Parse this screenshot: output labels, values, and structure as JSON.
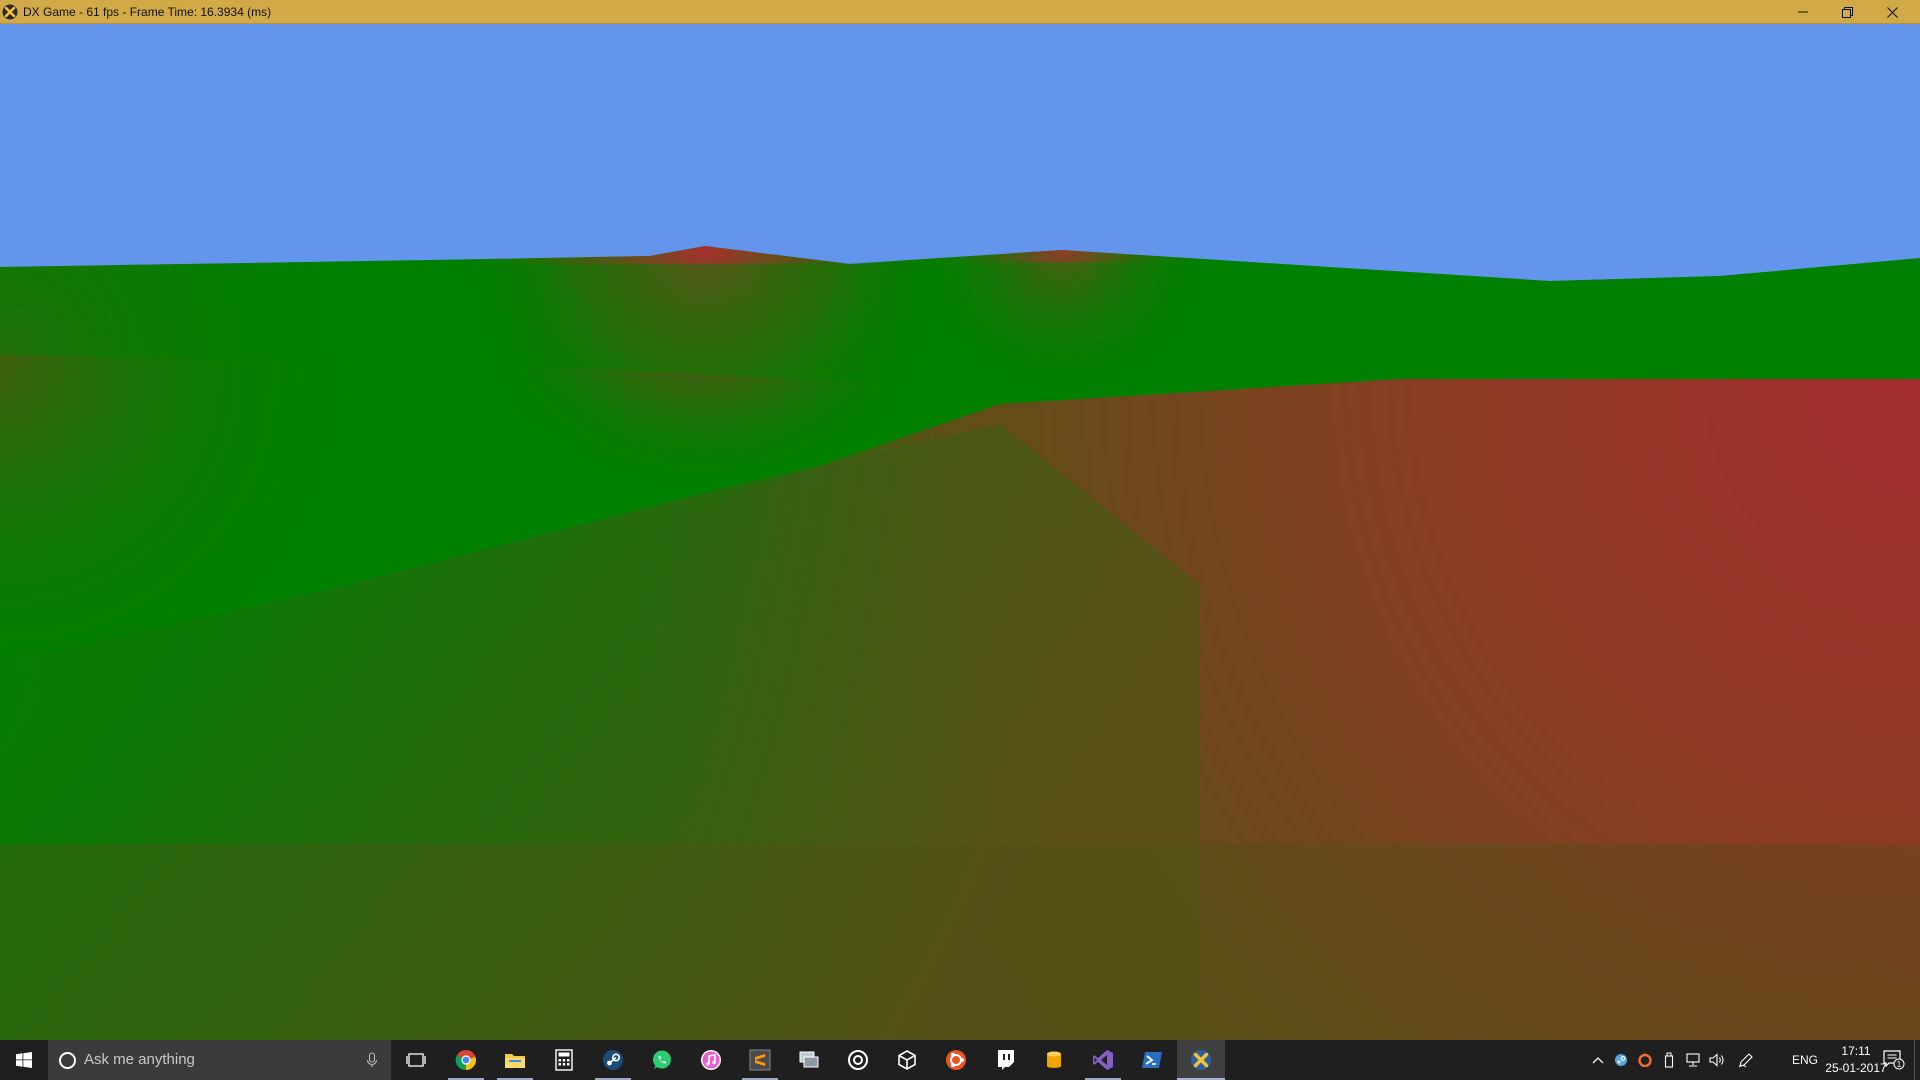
{
  "window": {
    "title": "DX Game - 61 fps - Frame Time: 16.3934 (ms)",
    "icon": "dx-x-icon",
    "controls": [
      "minimize-icon",
      "maximize-icon",
      "close-icon"
    ],
    "titlebar_color": "#d1aa47"
  },
  "scene": {
    "sky_color": "#6495ED",
    "grass_color": "#008000",
    "dirt_color": "#9c2d2d"
  },
  "taskbar": {
    "search_placeholder": "Ask me anything",
    "apps": [
      {
        "name": "task-view-icon",
        "running": false
      },
      {
        "name": "chrome-icon",
        "running": true
      },
      {
        "name": "file-explorer-icon",
        "running": true
      },
      {
        "name": "calculator-icon",
        "running": false
      },
      {
        "name": "steam-icon",
        "running": true
      },
      {
        "name": "whatsapp-icon",
        "running": false
      },
      {
        "name": "itunes-icon",
        "running": false
      },
      {
        "name": "sublime-text-icon",
        "running": true
      },
      {
        "name": "remote-desktop-icon",
        "running": false
      },
      {
        "name": "media-player-icon",
        "running": false
      },
      {
        "name": "unity-icon",
        "running": false
      },
      {
        "name": "ubuntu-icon",
        "running": false
      },
      {
        "name": "twitch-icon",
        "running": false
      },
      {
        "name": "database-icon",
        "running": false
      },
      {
        "name": "visual-studio-icon",
        "running": true
      },
      {
        "name": "powershell-icon",
        "running": false
      },
      {
        "name": "dx-game-icon",
        "running": true,
        "active": true
      }
    ],
    "tray_icons": [
      "chevron-up-icon",
      "steam-tray-icon",
      "origin-tray-icon",
      "usb-icon",
      "network-icon",
      "volume-icon",
      "pen-icon"
    ],
    "language": "ENG",
    "time": "17:11",
    "date": "25-01-2017",
    "notification_count": "1"
  }
}
